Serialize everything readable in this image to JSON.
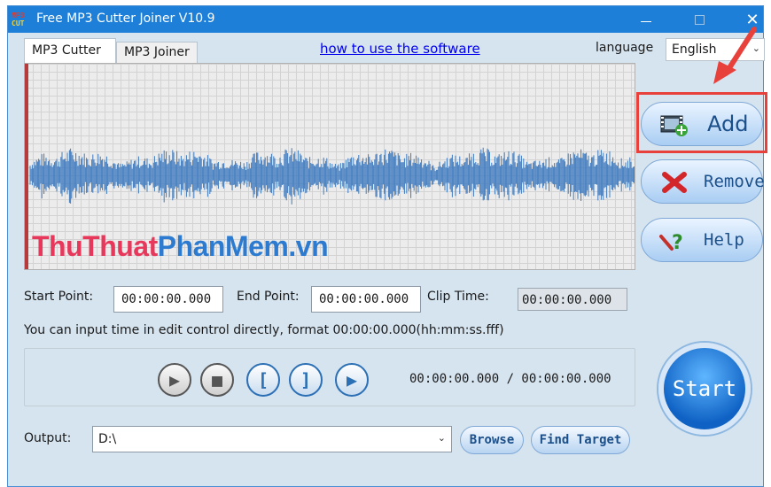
{
  "window": {
    "icon_text_top": "MP3",
    "icon_text_bottom": "CUT",
    "title": "Free MP3 Cutter Joiner V10.9",
    "min_symbol": "—",
    "max_symbol": "□",
    "close_symbol": "✕"
  },
  "tabs": [
    {
      "label": "MP3 Cutter",
      "active": true
    },
    {
      "label": "MP3 Joiner",
      "active": false
    }
  ],
  "link": {
    "label": "how to use the software"
  },
  "language": {
    "label": "language",
    "value": "English"
  },
  "watermark": {
    "part_a": "ThuThuat",
    "part_b": "PhanMem.vn"
  },
  "side_buttons": {
    "add": "Add",
    "remove": "Remove",
    "help": "Help"
  },
  "fields": {
    "start_label": "Start Point:",
    "start_value": "00:00:00.000",
    "end_label": "End Point:",
    "end_value": "00:00:00.000",
    "clip_label": "Clip Time:",
    "clip_value": "00:00:00.000"
  },
  "hint": "You can input time in edit control directly, format 00:00:00.000(hh:mm:ss.fff)",
  "player": {
    "play_glyph": "▶",
    "stop_glyph": "■",
    "mark_start_glyph": "[",
    "mark_end_glyph": "]",
    "play_sel_glyph": "▶",
    "time_readout": "00:00:00.000 / 00:00:00.000"
  },
  "start_button": "Start",
  "output": {
    "label": "Output:",
    "value": "D:\\",
    "browse_label": "Browse",
    "find_label": "Find Target"
  },
  "colors": {
    "titlebar": "#1e7fd8",
    "waveform": "#3f7bbf",
    "highlight": "#e8403a"
  }
}
